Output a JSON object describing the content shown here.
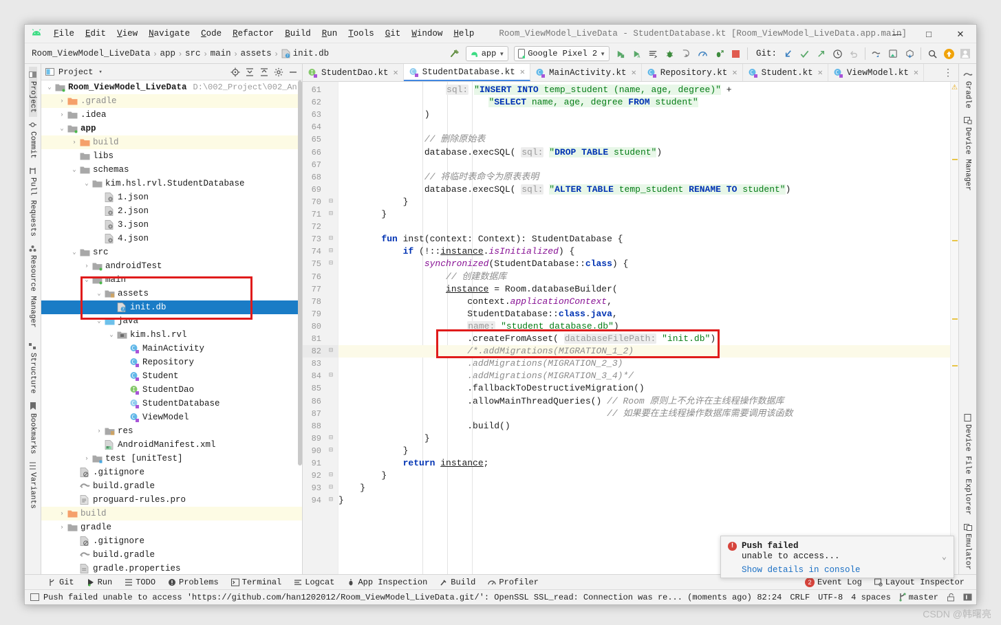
{
  "window": {
    "title": "Room_ViewModel_LiveData - StudentDatabase.kt [Room_ViewModel_LiveData.app.main]",
    "minimize": "—",
    "maximize": "□",
    "close": "✕"
  },
  "menu": {
    "items": [
      {
        "label": "File",
        "mnemonic": "F"
      },
      {
        "label": "Edit",
        "mnemonic": "E"
      },
      {
        "label": "View",
        "mnemonic": "V"
      },
      {
        "label": "Navigate",
        "mnemonic": "N"
      },
      {
        "label": "Code",
        "mnemonic": "C"
      },
      {
        "label": "Refactor",
        "mnemonic": "R"
      },
      {
        "label": "Build",
        "mnemonic": "B"
      },
      {
        "label": "Run",
        "mnemonic": "R"
      },
      {
        "label": "Tools",
        "mnemonic": "T"
      },
      {
        "label": "Git",
        "mnemonic": "G"
      },
      {
        "label": "Window",
        "mnemonic": "W"
      },
      {
        "label": "Help",
        "mnemonic": "H"
      }
    ]
  },
  "breadcrumb": {
    "items": [
      "Room_ViewModel_LiveData",
      "app",
      "src",
      "main",
      "assets",
      "init.db"
    ],
    "separator": "›"
  },
  "toolbar": {
    "run_config": "app",
    "device": "Google Pixel 2",
    "git_label": "Git:",
    "icons": [
      "hammer-build-icon",
      "run-icon",
      "run-with-coverage-icon",
      "edit-configurations-icon",
      "debug-icon",
      "run-step-icon",
      "profile-icon",
      "attach-debugger-icon",
      "stop-icon",
      "git-update-icon",
      "git-commit-icon",
      "git-push-icon",
      "history-icon",
      "undo-icon",
      "avd-manager-icon",
      "sdk-manager-icon",
      "layout-inspector-icon",
      "search-everywhere-icon",
      "update-available-icon",
      "user-account-icon"
    ]
  },
  "left_strip": {
    "items": [
      {
        "label": "Project",
        "icon": "project-icon",
        "selected": true
      },
      {
        "label": "Commit",
        "icon": "commit-icon",
        "selected": false
      },
      {
        "label": "Pull Requests",
        "icon": "pull-requests-icon",
        "selected": false
      },
      {
        "label": "Resource Manager",
        "icon": "resource-manager-icon",
        "selected": false
      },
      {
        "label": "Structure",
        "icon": "structure-icon",
        "selected": false
      },
      {
        "label": "Bookmarks",
        "icon": "bookmarks-icon",
        "selected": false
      },
      {
        "label": "Variants",
        "icon": "variants-icon",
        "selected": false
      }
    ]
  },
  "right_strip": {
    "items": [
      {
        "label": "Gradle",
        "icon": "gradle-icon"
      },
      {
        "label": "Device Manager",
        "icon": "device-manager-icon"
      },
      {
        "label": "Device File Explorer",
        "icon": "device-file-explorer-icon"
      },
      {
        "label": "Emulator",
        "icon": "emulator-icon"
      }
    ]
  },
  "project_panel": {
    "title": "Project",
    "caret": "▾",
    "header_icons": [
      "locate-icon",
      "expand-all-icon",
      "collapse-all-icon",
      "settings-gear-icon",
      "hide-icon"
    ],
    "tree": [
      {
        "indent": 0,
        "arrow": "⌄",
        "icon": "module-folder-icon",
        "label": "Room_ViewModel_LiveData",
        "path": "D:\\002_Project\\002_An",
        "bold": true,
        "state": "normal"
      },
      {
        "indent": 1,
        "arrow": "›",
        "icon": "excluded-folder-icon",
        "label": ".gradle",
        "path": "",
        "state": "highlight",
        "dim": true
      },
      {
        "indent": 1,
        "arrow": "›",
        "icon": "folder-icon",
        "label": ".idea",
        "path": "",
        "state": "normal"
      },
      {
        "indent": 1,
        "arrow": "⌄",
        "icon": "module-folder-icon",
        "label": "app",
        "path": "",
        "state": "normal",
        "bold": true
      },
      {
        "indent": 2,
        "arrow": "›",
        "icon": "excluded-folder-icon",
        "label": "build",
        "path": "",
        "state": "highlight",
        "dim": true
      },
      {
        "indent": 2,
        "arrow": "",
        "icon": "folder-icon",
        "label": "libs",
        "path": "",
        "state": "normal"
      },
      {
        "indent": 2,
        "arrow": "⌄",
        "icon": "folder-icon",
        "label": "schemas",
        "path": "",
        "state": "normal"
      },
      {
        "indent": 3,
        "arrow": "⌄",
        "icon": "folder-icon",
        "label": "kim.hsl.rvl.StudentDatabase",
        "path": "",
        "state": "normal"
      },
      {
        "indent": 4,
        "arrow": "",
        "icon": "json-file-icon",
        "label": "1.json",
        "path": "",
        "state": "normal"
      },
      {
        "indent": 4,
        "arrow": "",
        "icon": "json-file-icon",
        "label": "2.json",
        "path": "",
        "state": "normal"
      },
      {
        "indent": 4,
        "arrow": "",
        "icon": "json-file-icon",
        "label": "3.json",
        "path": "",
        "state": "normal"
      },
      {
        "indent": 4,
        "arrow": "",
        "icon": "json-file-icon",
        "label": "4.json",
        "path": "",
        "state": "normal"
      },
      {
        "indent": 2,
        "arrow": "⌄",
        "icon": "folder-icon",
        "label": "src",
        "path": "",
        "state": "normal"
      },
      {
        "indent": 3,
        "arrow": "›",
        "icon": "test-source-folder-icon",
        "label": "androidTest",
        "path": "",
        "state": "normal"
      },
      {
        "indent": 3,
        "arrow": "⌄",
        "icon": "source-folder-icon",
        "label": "main",
        "path": "",
        "state": "normal"
      },
      {
        "indent": 4,
        "arrow": "⌄",
        "icon": "assets-folder-icon",
        "label": "assets",
        "path": "",
        "state": "normal"
      },
      {
        "indent": 5,
        "arrow": "",
        "icon": "db-file-icon",
        "label": "init.db",
        "path": "",
        "state": "selected"
      },
      {
        "indent": 4,
        "arrow": "⌄",
        "icon": "java-source-folder-icon",
        "label": "java",
        "path": "",
        "state": "normal"
      },
      {
        "indent": 5,
        "arrow": "⌄",
        "icon": "package-icon",
        "label": "kim.hsl.rvl",
        "path": "",
        "state": "normal"
      },
      {
        "indent": 6,
        "arrow": "",
        "icon": "kotlin-class-icon",
        "label": "MainActivity",
        "path": "",
        "state": "normal"
      },
      {
        "indent": 6,
        "arrow": "",
        "icon": "kotlin-class-icon",
        "label": "Repository",
        "path": "",
        "state": "normal"
      },
      {
        "indent": 6,
        "arrow": "",
        "icon": "kotlin-class-icon",
        "label": "Student",
        "path": "",
        "state": "normal"
      },
      {
        "indent": 6,
        "arrow": "",
        "icon": "kotlin-interface-icon",
        "label": "StudentDao",
        "path": "",
        "state": "normal"
      },
      {
        "indent": 6,
        "arrow": "",
        "icon": "kotlin-abstract-class-icon",
        "label": "StudentDatabase",
        "path": "",
        "state": "normal"
      },
      {
        "indent": 6,
        "arrow": "",
        "icon": "kotlin-class-icon",
        "label": "ViewModel",
        "path": "",
        "state": "normal"
      },
      {
        "indent": 4,
        "arrow": "›",
        "icon": "res-folder-icon",
        "label": "res",
        "path": "",
        "state": "normal"
      },
      {
        "indent": 4,
        "arrow": "",
        "icon": "manifest-file-icon",
        "label": "AndroidManifest.xml",
        "path": "",
        "state": "normal"
      },
      {
        "indent": 3,
        "arrow": "›",
        "icon": "test-folder-icon",
        "label": "test [unitTest]",
        "path": "",
        "state": "normal"
      },
      {
        "indent": 2,
        "arrow": "",
        "icon": "gitignore-file-icon",
        "label": ".gitignore",
        "path": "",
        "state": "normal"
      },
      {
        "indent": 2,
        "arrow": "",
        "icon": "gradle-file-icon",
        "label": "build.gradle",
        "path": "",
        "state": "normal"
      },
      {
        "indent": 2,
        "arrow": "",
        "icon": "text-file-icon",
        "label": "proguard-rules.pro",
        "path": "",
        "state": "normal"
      },
      {
        "indent": 1,
        "arrow": "›",
        "icon": "excluded-folder-icon",
        "label": "build",
        "path": "",
        "state": "highlight",
        "dim": true
      },
      {
        "indent": 1,
        "arrow": "›",
        "icon": "folder-icon",
        "label": "gradle",
        "path": "",
        "state": "normal"
      },
      {
        "indent": 2,
        "arrow": "",
        "icon": "gitignore-file-icon",
        "label": ".gitignore",
        "path": "",
        "state": "normal"
      },
      {
        "indent": 2,
        "arrow": "",
        "icon": "gradle-file-icon",
        "label": "build.gradle",
        "path": "",
        "state": "normal"
      },
      {
        "indent": 2,
        "arrow": "",
        "icon": "properties-file-icon",
        "label": "gradle.properties",
        "path": "",
        "state": "normal"
      }
    ]
  },
  "editor": {
    "tabs": [
      {
        "label": "StudentDao.kt",
        "icon": "kotlin-interface-icon",
        "active": false
      },
      {
        "label": "StudentDatabase.kt",
        "icon": "kotlin-abstract-class-icon",
        "active": true
      },
      {
        "label": "MainActivity.kt",
        "icon": "kotlin-class-icon",
        "active": false
      },
      {
        "label": "Repository.kt",
        "icon": "kotlin-class-icon",
        "active": false
      },
      {
        "label": "Student.kt",
        "icon": "kotlin-class-icon",
        "active": false
      },
      {
        "label": "ViewModel.kt",
        "icon": "kotlin-class-icon",
        "active": false
      }
    ],
    "tab_close": "✕",
    "more_tabs": "⋮",
    "first_line_number": 61,
    "lines": [
      {
        "n": 61,
        "text": "                    sql: \"INSERT INTO temp_student (name, age, degree)\" +"
      },
      {
        "n": 62,
        "text": "                            \"SELECT name, age, degree FROM student\""
      },
      {
        "n": 63,
        "text": "                )"
      },
      {
        "n": 64,
        "text": ""
      },
      {
        "n": 65,
        "text": "                // 删除原始表"
      },
      {
        "n": 66,
        "text": "                database.execSQL( sql: \"DROP TABLE student\")"
      },
      {
        "n": 67,
        "text": ""
      },
      {
        "n": 68,
        "text": "                // 将临时表命令为原表表明"
      },
      {
        "n": 69,
        "text": "                database.execSQL( sql: \"ALTER TABLE temp_student RENAME TO student\")"
      },
      {
        "n": 70,
        "text": "            }"
      },
      {
        "n": 71,
        "text": "        }"
      },
      {
        "n": 72,
        "text": ""
      },
      {
        "n": 73,
        "text": "        fun inst(context: Context): StudentDatabase {"
      },
      {
        "n": 74,
        "text": "            if (!::instance.isInitialized) {"
      },
      {
        "n": 75,
        "text": "                synchronized(StudentDatabase::class) {"
      },
      {
        "n": 76,
        "text": "                    // 创建数据库"
      },
      {
        "n": 77,
        "text": "                    instance = Room.databaseBuilder("
      },
      {
        "n": 78,
        "text": "                        context.applicationContext,"
      },
      {
        "n": 79,
        "text": "                        StudentDatabase::class.java,"
      },
      {
        "n": 80,
        "text": "                        name: \"student_database.db\")"
      },
      {
        "n": 81,
        "text": "                        .createFromAsset( databaseFilePath: \"init.db\")"
      },
      {
        "n": 82,
        "text": "                        /*.addMigrations(MIGRATION_1_2)"
      },
      {
        "n": 83,
        "text": "                        .addMigrations(MIGRATION_2_3)"
      },
      {
        "n": 84,
        "text": "                        .addMigrations(MIGRATION_3_4)*/"
      },
      {
        "n": 85,
        "text": "                        .fallbackToDestructiveMigration()"
      },
      {
        "n": 86,
        "text": "                        .allowMainThreadQueries() // Room 原则上不允许在主线程操作数据库"
      },
      {
        "n": 87,
        "text": "                                                  // 如果要在主线程操作数据库需要调用该函数"
      },
      {
        "n": 88,
        "text": "                        .build()"
      },
      {
        "n": 89,
        "text": "                }"
      },
      {
        "n": 90,
        "text": "            }"
      },
      {
        "n": 91,
        "text": "            return instance;"
      },
      {
        "n": 92,
        "text": "        }"
      },
      {
        "n": 93,
        "text": "    }"
      },
      {
        "n": 94,
        "text": "}"
      }
    ]
  },
  "notification": {
    "title": "Push failed",
    "message": "unable to access...",
    "link": "Show details in console",
    "icon": "error-icon",
    "collapse": "⌄"
  },
  "tool_window_bar": {
    "left_items": [
      {
        "label": "Git",
        "icon": "git-branch-icon"
      },
      {
        "label": "Run",
        "icon": "run-icon"
      },
      {
        "label": "TODO",
        "icon": "todo-icon"
      },
      {
        "label": "Problems",
        "icon": "problems-icon"
      },
      {
        "label": "Terminal",
        "icon": "terminal-icon"
      },
      {
        "label": "Logcat",
        "icon": "logcat-icon"
      },
      {
        "label": "App Inspection",
        "icon": "app-inspection-icon"
      },
      {
        "label": "Build",
        "icon": "build-hammer-icon"
      },
      {
        "label": "Profiler",
        "icon": "profiler-icon"
      }
    ],
    "right_items": [
      {
        "label": "Event Log",
        "icon": "event-log-icon",
        "badge": "2"
      },
      {
        "label": "Layout Inspector",
        "icon": "layout-inspector-icon",
        "badge": ""
      }
    ]
  },
  "status_bar": {
    "message": "Push failed unable to access 'https://github.com/han1202012/Room_ViewModel_LiveData.git/': OpenSSL SSL_read: Connection was re... (moments ago)",
    "caret_position": "82:24",
    "line_separator": "CRLF",
    "encoding": "UTF-8",
    "indent": "4 spaces",
    "branch": "master",
    "icons": [
      "message-icon",
      "branch-icon",
      "lock-open-icon",
      "notifications-icon"
    ]
  },
  "watermark": "CSDN @韩曙亮",
  "colors": {
    "selection_blue": "#1a7cc6",
    "annotation_red": "#e01b1b",
    "keyword_blue": "#0033b3",
    "string_green": "#067d17",
    "comment_gray": "#8c8c8c",
    "highlight_yellow": "#fdfbe4",
    "accent_orange": "#f5a623"
  }
}
